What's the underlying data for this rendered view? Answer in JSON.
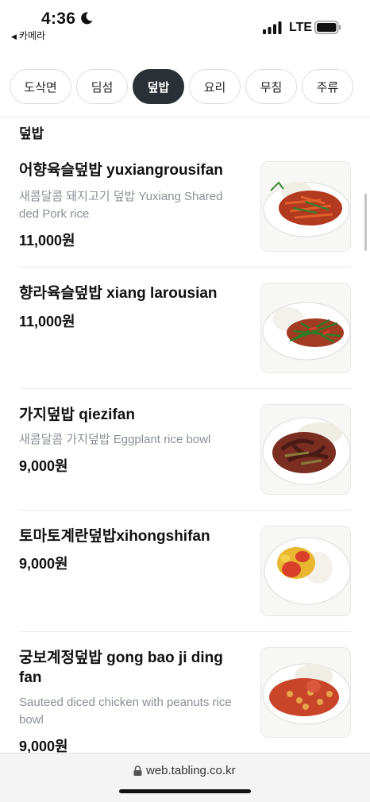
{
  "status_bar": {
    "time": "4:36",
    "back_label": "카메라",
    "network": "LTE"
  },
  "tabs": [
    {
      "label": "도삭면",
      "active": false
    },
    {
      "label": "딤섬",
      "active": false
    },
    {
      "label": "덮밥",
      "active": true
    },
    {
      "label": "요리",
      "active": false
    },
    {
      "label": "무침",
      "active": false
    },
    {
      "label": "주류",
      "active": false
    }
  ],
  "section": {
    "title": "덮밥"
  },
  "items": [
    {
      "name": "어향육슬덮밥 yuxiangrousifan",
      "description": "새콤달콤 돼지고기 덮밥 Yuxiang Shared ded Pork rice",
      "price": "11,000원",
      "image": "shredded-pork-rice-photo"
    },
    {
      "name": "향라육슬덮밥 xiang larousian",
      "description": "",
      "price": "11,000원",
      "image": "spicy-pork-greens-rice-photo"
    },
    {
      "name": "가지덮밥 qiezifan",
      "description": "새콤달콤 가지덮밥 Eggplant rice bowl",
      "price": "9,000원",
      "image": "eggplant-rice-photo"
    },
    {
      "name": "토마토계란덮밥xihongshifan",
      "description": "",
      "price": "9,000원",
      "image": "tomato-egg-rice-photo"
    },
    {
      "name": "궁보계정덮밥 gong bao ji ding fan",
      "description": "Sauteed diced chicken with peanuts rice bowl",
      "price": "9,000원",
      "image": "kung-pao-chicken-rice-photo"
    }
  ],
  "url_bar": {
    "url": "web.tabling.co.kr"
  },
  "colors": {
    "active_tab": "#2b2f36",
    "description_text": "#8a8f96"
  }
}
